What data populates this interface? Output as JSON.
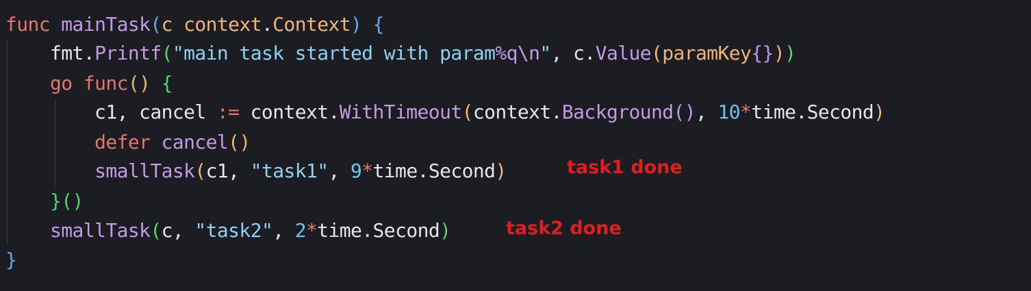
{
  "code": {
    "language": "go",
    "lines": [
      [
        {
          "t": "func",
          "c": "kw"
        },
        {
          "t": " ",
          "c": "pl"
        },
        {
          "t": "mainTask",
          "c": "fn"
        },
        {
          "t": "(",
          "c": "b1"
        },
        {
          "t": "c",
          "c": "ty"
        },
        {
          "t": " ",
          "c": "pl"
        },
        {
          "t": "context",
          "c": "ty"
        },
        {
          "t": ".",
          "c": "pl"
        },
        {
          "t": "Context",
          "c": "ty"
        },
        {
          "t": ")",
          "c": "b1"
        },
        {
          "t": " ",
          "c": "pl"
        },
        {
          "t": "{",
          "c": "b1"
        }
      ],
      [
        {
          "t": "    fmt",
          "c": "pl"
        },
        {
          "t": ".",
          "c": "pl"
        },
        {
          "t": "Printf",
          "c": "fn"
        },
        {
          "t": "(",
          "c": "b4"
        },
        {
          "t": "\"main task started with param",
          "c": "st"
        },
        {
          "t": "%q\\n",
          "c": "esc"
        },
        {
          "t": "\"",
          "c": "st"
        },
        {
          "t": ", c.",
          "c": "pl"
        },
        {
          "t": "Value",
          "c": "fn"
        },
        {
          "t": "(",
          "c": "b2"
        },
        {
          "t": "paramKey",
          "c": "ty"
        },
        {
          "t": "{}",
          "c": "b3"
        },
        {
          "t": ")",
          "c": "b2"
        },
        {
          "t": ")",
          "c": "b4"
        }
      ],
      [
        {
          "t": "    ",
          "c": "pl"
        },
        {
          "t": "go",
          "c": "kw"
        },
        {
          "t": " ",
          "c": "pl"
        },
        {
          "t": "func",
          "c": "kw"
        },
        {
          "t": "()",
          "c": "b2"
        },
        {
          "t": " ",
          "c": "pl"
        },
        {
          "t": "{",
          "c": "b4"
        }
      ],
      [
        {
          "t": "        c1, cancel ",
          "c": "pl"
        },
        {
          "t": ":=",
          "c": "op"
        },
        {
          "t": " context.",
          "c": "pl"
        },
        {
          "t": "WithTimeout",
          "c": "fn"
        },
        {
          "t": "(",
          "c": "b2"
        },
        {
          "t": "context.",
          "c": "pl"
        },
        {
          "t": "Background",
          "c": "fn"
        },
        {
          "t": "()",
          "c": "b3"
        },
        {
          "t": ", ",
          "c": "pl"
        },
        {
          "t": "10",
          "c": "nm"
        },
        {
          "t": "*",
          "c": "op"
        },
        {
          "t": "time.Second",
          "c": "pl"
        },
        {
          "t": ")",
          "c": "b2"
        }
      ],
      [
        {
          "t": "        ",
          "c": "pl"
        },
        {
          "t": "defer",
          "c": "kw"
        },
        {
          "t": " ",
          "c": "pl"
        },
        {
          "t": "cancel",
          "c": "fn"
        },
        {
          "t": "()",
          "c": "b2"
        }
      ],
      [
        {
          "t": "        ",
          "c": "pl"
        },
        {
          "t": "smallTask",
          "c": "fn"
        },
        {
          "t": "(",
          "c": "b2"
        },
        {
          "t": "c1, ",
          "c": "pl"
        },
        {
          "t": "\"task1\"",
          "c": "st"
        },
        {
          "t": ", ",
          "c": "pl"
        },
        {
          "t": "9",
          "c": "nm"
        },
        {
          "t": "*",
          "c": "op"
        },
        {
          "t": "time.Second",
          "c": "pl"
        },
        {
          "t": ")",
          "c": "b2"
        }
      ],
      [
        {
          "t": "    ",
          "c": "pl"
        },
        {
          "t": "}",
          "c": "b4"
        },
        {
          "t": "()",
          "c": "b4"
        }
      ],
      [
        {
          "t": "    ",
          "c": "pl"
        },
        {
          "t": "smallTask",
          "c": "fn"
        },
        {
          "t": "(",
          "c": "b4"
        },
        {
          "t": "c, ",
          "c": "pl"
        },
        {
          "t": "\"task2\"",
          "c": "st"
        },
        {
          "t": ", ",
          "c": "pl"
        },
        {
          "t": "2",
          "c": "nm"
        },
        {
          "t": "*",
          "c": "op"
        },
        {
          "t": "time.Second",
          "c": "pl"
        },
        {
          "t": ")",
          "c": "b4"
        }
      ],
      [
        {
          "t": "}",
          "c": "b1"
        }
      ]
    ]
  },
  "annotations": {
    "task1": "task1 done",
    "task2": "task2 done"
  },
  "colors": {
    "background": "#1b1d23",
    "keyword": "#e5766b",
    "function": "#c39ae4",
    "plain": "#e4e6ea",
    "type": "#f0b478",
    "string": "#8fd1f0",
    "number": "#6ec6f0",
    "annotation": "#e01e1e"
  }
}
